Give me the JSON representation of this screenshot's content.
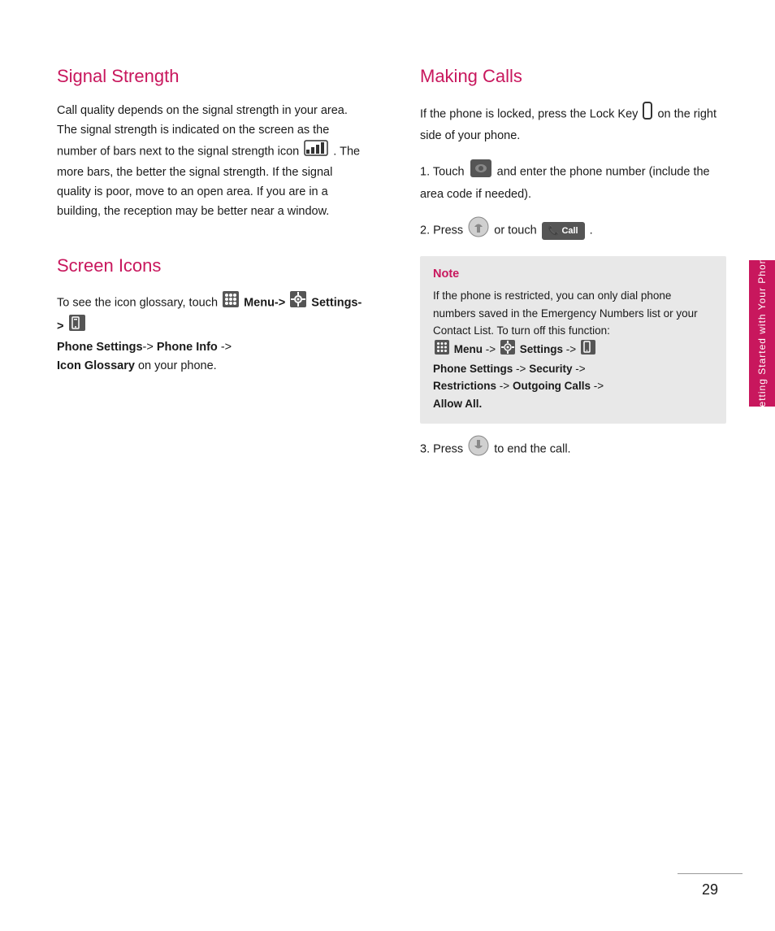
{
  "page": {
    "number": "29",
    "side_tab_text": "Getting Started with Your Phone"
  },
  "signal_strength": {
    "title": "Signal Strength",
    "paragraph": "Call quality depends on the signal strength in your area. The signal strength is indicated on the screen as the number of bars next to the signal strength icon",
    "paragraph2": ". The more bars, the better the signal strength. If the signal quality is poor, move to an open area. If you are in a building, the reception may be better near a window."
  },
  "screen_icons": {
    "title": "Screen Icons",
    "text1": "To see the icon glossary, touch",
    "menu_label": "Menu->",
    "settings_label": "Settings->",
    "text2": "Phone Settings",
    "arrow1": "->",
    "text3": "Phone Info",
    "arrow2": "->",
    "text4": "Icon Glossary",
    "text5": "on your phone."
  },
  "making_calls": {
    "title": "Making Calls",
    "intro": "If the phone is locked, press the Lock Key",
    "intro2": "on the right side of your phone.",
    "step1_prefix": "1. Touch",
    "step1_text": "and enter the phone number (include the area code if needed).",
    "step2_prefix": "2. Press",
    "step2_middle": "or touch",
    "step3_prefix": "3. Press",
    "step3_suffix": "to end the call."
  },
  "note": {
    "title": "Note",
    "text1": "If the phone is restricted, you can only dial phone numbers saved in the Emergency Numbers list or your Contact List. To turn off this function:",
    "menu_label": "Menu",
    "arrow1": "->",
    "settings_label": "Settings",
    "arrow2": "->",
    "line2": "Phone Settings",
    "arrow3": "->",
    "line2b": "Security",
    "arrow4": "->",
    "line3": "Restrictions",
    "arrow5": "->",
    "line3b": "Outgoing Calls",
    "arrow6": "->",
    "line4": "Allow All."
  }
}
